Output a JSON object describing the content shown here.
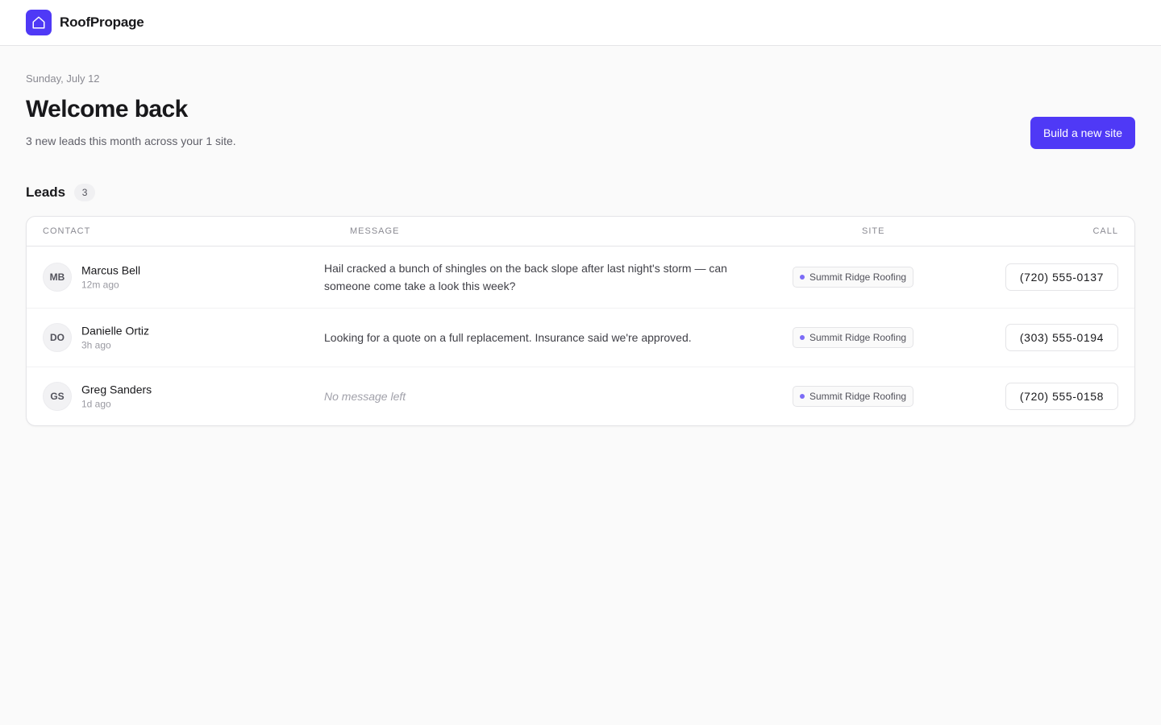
{
  "app": {
    "name": "RoofPropage",
    "logo_icon": "house-icon",
    "accent": "#4f39f6"
  },
  "header": {
    "date": "Sunday, July 12",
    "title": "Welcome back",
    "subtitle": "3 new leads this month across your 1 site.",
    "build_button": "Build a new site"
  },
  "leads": {
    "title": "Leads",
    "count": "3",
    "columns": {
      "contact": "CONTACT",
      "message": "MESSAGE",
      "site": "SITE",
      "call": "CALL"
    },
    "rows": [
      {
        "initials": "MB",
        "name": "Marcus Bell",
        "time": "12m ago",
        "message": "Hail cracked a bunch of shingles on the back slope after last night's storm — can someone come take a look this week?",
        "site": "Summit Ridge Roofing",
        "phone": "(720) 555-0137"
      },
      {
        "initials": "DO",
        "name": "Danielle Ortiz",
        "time": "3h ago",
        "message": "Looking for a quote on a full replacement. Insurance said we're approved.",
        "site": "Summit Ridge Roofing",
        "phone": "(303) 555-0194"
      },
      {
        "initials": "GS",
        "name": "Greg Sanders",
        "time": "1d ago",
        "message": "No message left",
        "site": "Summit Ridge Roofing",
        "phone": "(720) 555-0158"
      }
    ]
  }
}
